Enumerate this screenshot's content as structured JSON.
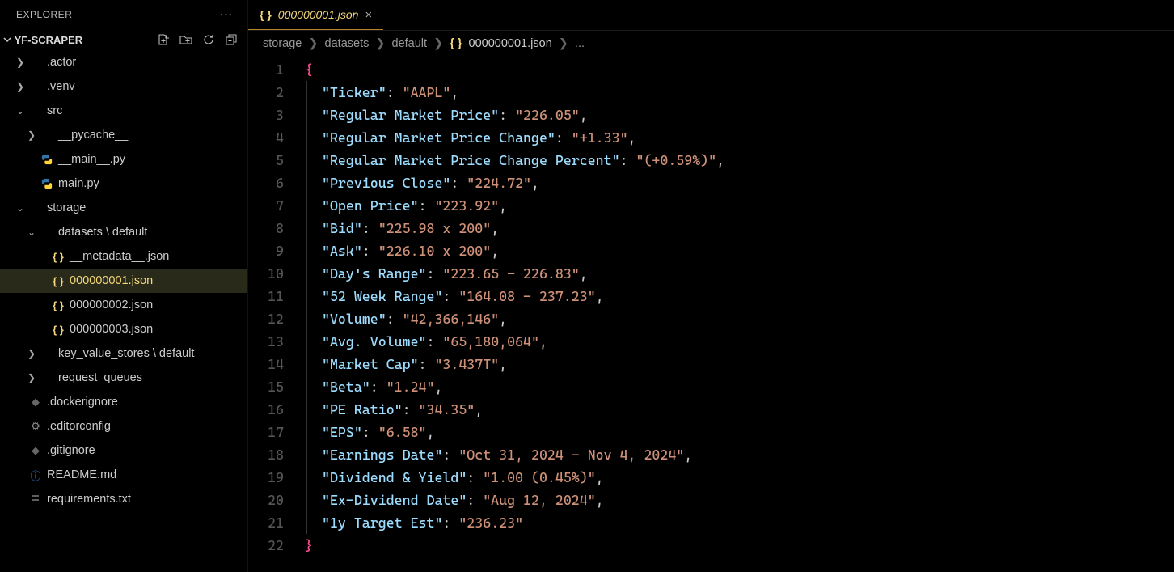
{
  "explorer": {
    "title": "EXPLORER"
  },
  "workspace": {
    "name": "YF-SCRAPER"
  },
  "tree": [
    {
      "indent": 0,
      "chev": "right",
      "icon": "",
      "label": ".actor",
      "kind": "folder"
    },
    {
      "indent": 0,
      "chev": "right",
      "icon": "",
      "label": ".venv",
      "kind": "folder"
    },
    {
      "indent": 0,
      "chev": "down",
      "icon": "",
      "label": "src",
      "kind": "folder"
    },
    {
      "indent": 1,
      "chev": "right",
      "icon": "",
      "label": "__pycache__",
      "kind": "folder"
    },
    {
      "indent": 1,
      "chev": "",
      "icon": "py",
      "label": "__main__.py",
      "kind": "file"
    },
    {
      "indent": 1,
      "chev": "",
      "icon": "py",
      "label": "main.py",
      "kind": "file"
    },
    {
      "indent": 0,
      "chev": "down",
      "icon": "",
      "label": "storage",
      "kind": "folder"
    },
    {
      "indent": 1,
      "chev": "down",
      "icon": "",
      "label": "datasets \\ default",
      "kind": "folder"
    },
    {
      "indent": 2,
      "chev": "",
      "icon": "json",
      "label": "__metadata__.json",
      "kind": "file"
    },
    {
      "indent": 2,
      "chev": "",
      "icon": "json",
      "label": "000000001.json",
      "kind": "file",
      "active": true
    },
    {
      "indent": 2,
      "chev": "",
      "icon": "json",
      "label": "000000002.json",
      "kind": "file"
    },
    {
      "indent": 2,
      "chev": "",
      "icon": "json",
      "label": "000000003.json",
      "kind": "file"
    },
    {
      "indent": 1,
      "chev": "right",
      "icon": "",
      "label": "key_value_stores \\ default",
      "kind": "folder"
    },
    {
      "indent": 1,
      "chev": "right",
      "icon": "",
      "label": "request_queues",
      "kind": "folder"
    },
    {
      "indent": 0,
      "chev": "",
      "icon": "dim",
      "label": ".dockerignore",
      "kind": "file"
    },
    {
      "indent": 0,
      "chev": "",
      "icon": "gear",
      "label": ".editorconfig",
      "kind": "file"
    },
    {
      "indent": 0,
      "chev": "",
      "icon": "dim",
      "label": ".gitignore",
      "kind": "file"
    },
    {
      "indent": 0,
      "chev": "",
      "icon": "info",
      "label": "README.md",
      "kind": "file"
    },
    {
      "indent": 0,
      "chev": "",
      "icon": "lines",
      "label": "requirements.txt",
      "kind": "file"
    }
  ],
  "tab": {
    "icon": "json",
    "label": "000000001.json"
  },
  "breadcrumb": {
    "parts": [
      "storage",
      "datasets",
      "default"
    ],
    "file": "000000001.json",
    "tail": "..."
  },
  "json_lines": [
    {
      "n": 1,
      "type": "open"
    },
    {
      "n": 2,
      "key": "Ticker",
      "val": "AAPL",
      "comma": true
    },
    {
      "n": 3,
      "key": "Regular Market Price",
      "val": "226.05",
      "comma": true
    },
    {
      "n": 4,
      "key": "Regular Market Price Change",
      "val": "+1.33",
      "comma": true
    },
    {
      "n": 5,
      "key": "Regular Market Price Change Percent",
      "val": "(+0.59%)",
      "comma": true
    },
    {
      "n": 6,
      "key": "Previous Close",
      "val": "224.72",
      "comma": true
    },
    {
      "n": 7,
      "key": "Open Price",
      "val": "223.92",
      "comma": true
    },
    {
      "n": 8,
      "key": "Bid",
      "val": "225.98 x 200",
      "comma": true
    },
    {
      "n": 9,
      "key": "Ask",
      "val": "226.10 x 200",
      "comma": true
    },
    {
      "n": 10,
      "key": "Day's Range",
      "val": "223.65 - 226.83",
      "comma": true
    },
    {
      "n": 11,
      "key": "52 Week Range",
      "val": "164.08 - 237.23",
      "comma": true
    },
    {
      "n": 12,
      "key": "Volume",
      "val": "42,366,146",
      "comma": true
    },
    {
      "n": 13,
      "key": "Avg. Volume",
      "val": "65,180,064",
      "comma": true
    },
    {
      "n": 14,
      "key": "Market Cap",
      "val": "3.437T",
      "comma": true
    },
    {
      "n": 15,
      "key": "Beta",
      "val": "1.24",
      "comma": true
    },
    {
      "n": 16,
      "key": "PE Ratio",
      "val": "34.35",
      "comma": true
    },
    {
      "n": 17,
      "key": "EPS",
      "val": "6.58",
      "comma": true
    },
    {
      "n": 18,
      "key": "Earnings Date",
      "val": "Oct 31, 2024 - Nov 4, 2024",
      "comma": true
    },
    {
      "n": 19,
      "key": "Dividend & Yield",
      "val": "1.00 (0.45%)",
      "comma": true
    },
    {
      "n": 20,
      "key": "Ex-Dividend Date",
      "val": "Aug 12, 2024",
      "comma": true
    },
    {
      "n": 21,
      "key": "1y Target Est",
      "val": "236.23",
      "comma": false
    },
    {
      "n": 22,
      "type": "close"
    }
  ]
}
